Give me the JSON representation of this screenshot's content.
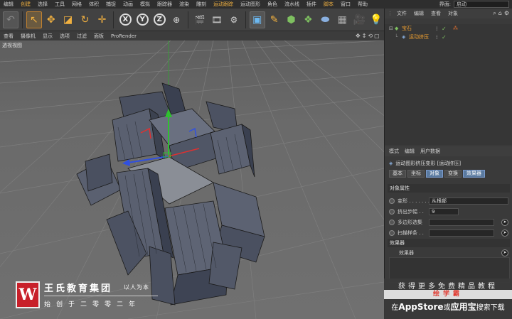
{
  "menu": [
    "编辑",
    "创建",
    "选择",
    "工具",
    "网格",
    "体积",
    "捕捉",
    "动画",
    "模拟",
    "跟踪器",
    "渲染",
    "雕刻",
    "运动跟踪",
    "运动图形",
    "角色",
    "流水线",
    "插件",
    "脚本",
    "窗口",
    "帮助"
  ],
  "layout": {
    "label": "界面:",
    "value": "启动"
  },
  "viewport_menu": [
    "查看",
    "摄像机",
    "显示",
    "选项",
    "过滤",
    "面板",
    "ProRender"
  ],
  "viewport_label": "透视视图",
  "axis_buttons": [
    "X",
    "Y",
    "Z"
  ],
  "object_manager": {
    "menu": [
      "文件",
      "编辑",
      "查看",
      "对象"
    ],
    "objects": [
      {
        "name": "宝石",
        "color": "#f0a030"
      },
      {
        "name": "运动挤压",
        "color": "#f0a030"
      }
    ]
  },
  "attributes": {
    "menu": [
      "模式",
      "编辑",
      "用户数据"
    ],
    "title": "运动图形挤压变形 [运动挤压]",
    "tabs": [
      "基本",
      "坐标",
      "对象",
      "变换",
      "效果器"
    ],
    "active_tabs": [
      "对象",
      "效果器"
    ],
    "section_object": "对象属性",
    "props": [
      {
        "label": "变形 . . . . . . .",
        "value": "从根部"
      },
      {
        "label": "挤出步幅 . .",
        "value": "9"
      },
      {
        "label": "多边形选集",
        "value": ""
      },
      {
        "label": "扫描样条 . .",
        "value": ""
      }
    ],
    "section_effectors": "效果器",
    "effectors_label": "效果器"
  },
  "ad": {
    "line1": "获得更多免费精品教程",
    "line2": "绘学霸",
    "line3_pre": "在",
    "line3_app": "AppStore",
    "line3_mid": "或",
    "line3_yyb": "应用宝",
    "line3_post": "搜索下载"
  },
  "logo": {
    "mark": "W",
    "name": "王氏教育集团",
    "motto": "以人为本",
    "since": "始创于二零零二年"
  }
}
